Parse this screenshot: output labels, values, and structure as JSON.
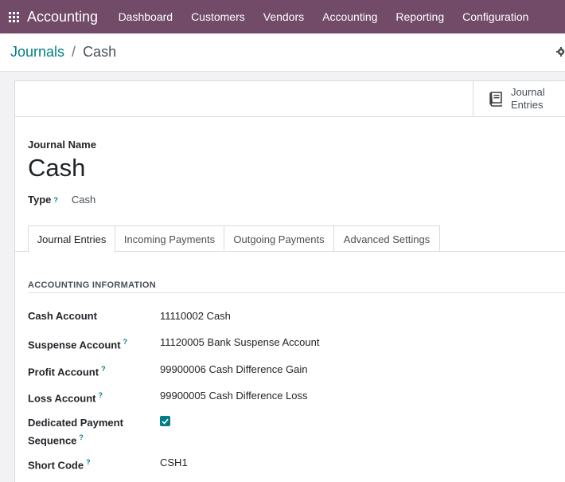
{
  "navbar": {
    "brand": "Accounting",
    "menu": [
      "Dashboard",
      "Customers",
      "Vendors",
      "Accounting",
      "Reporting",
      "Configuration"
    ]
  },
  "breadcrumb": {
    "parent": "Journals",
    "separator": "/",
    "current": "Cash"
  },
  "smart_button": {
    "line1": "Journal",
    "line2": "Entries"
  },
  "form": {
    "name_label": "Journal Name",
    "name_value": "Cash",
    "type_label": "Type",
    "type_value": "Cash",
    "help_mark": "?"
  },
  "tabs": [
    {
      "label": "Journal Entries",
      "active": true
    },
    {
      "label": "Incoming Payments",
      "active": false
    },
    {
      "label": "Outgoing Payments",
      "active": false
    },
    {
      "label": "Advanced Settings",
      "active": false
    }
  ],
  "section": {
    "title": "ACCOUNTING INFORMATION"
  },
  "fields": {
    "cash_account": {
      "label": "Cash Account",
      "value": "11110002 Cash"
    },
    "suspense_account": {
      "label": "Suspense Account",
      "value": "11120005 Bank Suspense Account"
    },
    "profit_account": {
      "label": "Profit Account",
      "value": "99900006 Cash Difference Gain"
    },
    "loss_account": {
      "label": "Loss Account",
      "value": "99900005 Cash Difference Loss"
    },
    "dedicated_seq": {
      "label_line1": "Dedicated Payment",
      "label_line2": "Sequence",
      "checked": true
    },
    "short_code": {
      "label": "Short Code",
      "value": "CSH1"
    }
  },
  "colors": {
    "navbar": "#714b67",
    "accent": "#017e84"
  }
}
